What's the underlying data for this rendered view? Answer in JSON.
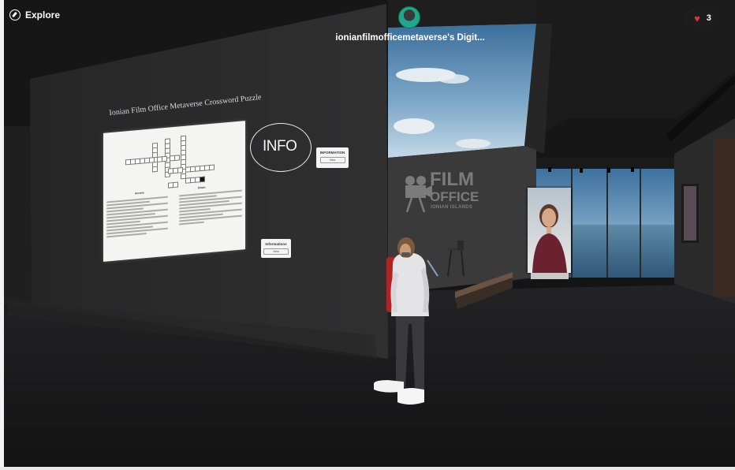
{
  "topbar": {
    "explore_label": "Explore",
    "space_title": "ionianfilmofficemetaverse's Digit...",
    "likes_count": "3"
  },
  "scene": {
    "puzzle_title": "Ionian Film Office Metaverse Crossword Puzzle",
    "info_sign": "INFO",
    "info_card_1": {
      "title": "INFORMATION",
      "button": "View"
    },
    "info_card_2": {
      "title": "Informations",
      "button": "View"
    },
    "film_office_sign": {
      "line1": "FILM",
      "line2": "OFFICE",
      "line3": "IONIAN ISLANDS"
    },
    "crossword": {
      "across_header": "Across",
      "down_header": "Down"
    }
  },
  "colors": {
    "accent_heart": "#e0323c",
    "avatar_ring": "#1fa88a"
  },
  "icons": {
    "explore": "compass-icon",
    "likes": "heart-icon"
  }
}
